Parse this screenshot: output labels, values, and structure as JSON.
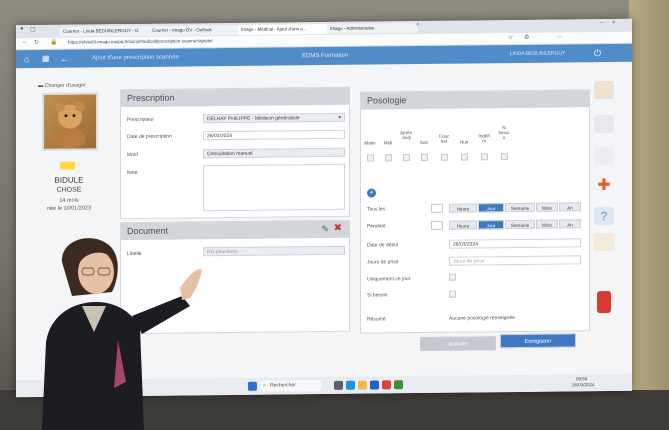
{
  "browser": {
    "tabs": [
      {
        "label": "Courrier - Linda BEDUINLERGUY - O"
      },
      {
        "label": "Courrier - Imago DV - Outlook"
      },
      {
        "label": "Imago - Médical - Ajout d'une p..."
      },
      {
        "label": "Imago - Administrative"
      }
    ],
    "url": "https://ehtis03-imago.easpa.fr/soins/medical/prescription-scanner/ajouter"
  },
  "app": {
    "header_title": "Ajout d'une prescription scannée",
    "center_label": "EDMS Formation",
    "user_label": "LINDA BEDUINLERGUY"
  },
  "patient": {
    "change_label": "Changer d'usager",
    "first_name": "BIDULE",
    "last_name": "CHOSE",
    "age": "14 mois",
    "birth": "née le 10/01/2023"
  },
  "prescription": {
    "title": "Prescription",
    "prescripteur_label": "Prescripteur",
    "prescripteur_value": "DELHAY PHILIPPE - Médecin généraliste",
    "date_label": "Date de prescription",
    "date_value": "26/03/2024",
    "motif_label": "Motif",
    "motif_value": "Consultation manuel",
    "note_label": "Note"
  },
  "document": {
    "title": "Document",
    "libelle_label": "Libellé",
    "libelle_placeholder": "RO pouchons"
  },
  "posologie": {
    "title": "Posologie",
    "columns": [
      "Matin",
      "Midi",
      "Après -midi",
      "Soir",
      "Couc her",
      "Nuit",
      "Indéfi ni",
      "Si besoi n"
    ],
    "tous_les_label": "Tous les",
    "pendant_label": "Pendant",
    "period_buttons": [
      "Heure",
      "Jour",
      "Semaine",
      "Mois",
      "An"
    ],
    "date_debut_label": "Date de début",
    "date_debut_value": "26/03/2024",
    "jours_label": "Jours de prise",
    "jours_placeholder": "Jours de prise",
    "uniquement_label": "Uniquement ce jour",
    "si_besoin_label": "Si besoin",
    "resume_label": "Résumé",
    "resume_value": "Aucune posologie renseignée"
  },
  "actions": {
    "cancel_label": "Annuler",
    "save_label": "Enregistrer"
  },
  "taskbar": {
    "search_placeholder": "Rechercher",
    "time": "09:56",
    "date": "26/03/2024"
  },
  "colors": {
    "app_header": "#4f8cc9",
    "primary_button": "#3f79c4",
    "panel_head": "#d2d6db"
  }
}
